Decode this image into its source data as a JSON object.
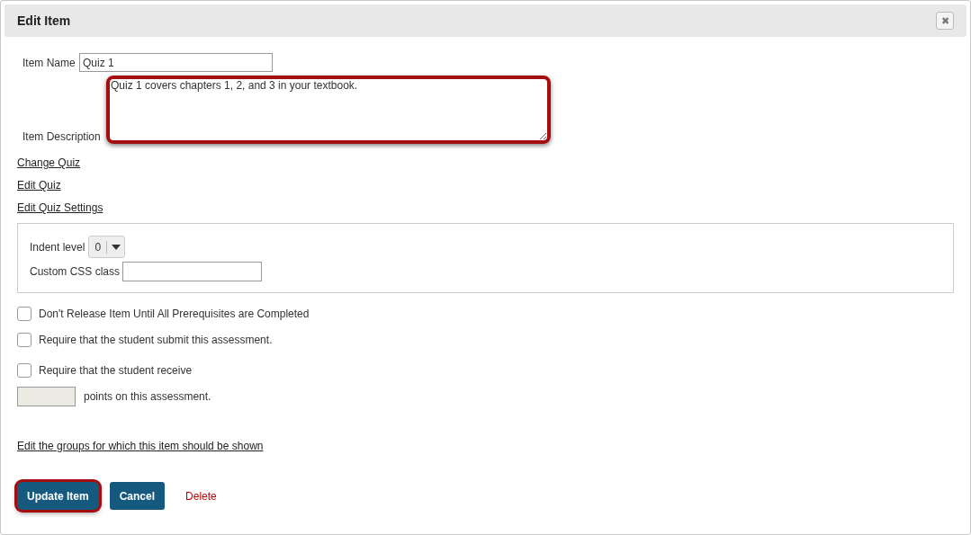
{
  "dialog": {
    "title": "Edit Item",
    "close_glyph": "✖"
  },
  "form": {
    "item_name": {
      "label": "Item Name",
      "value": "Quiz 1"
    },
    "item_description": {
      "label": "Item Description",
      "value": "Quiz 1 covers chapters 1, 2, and 3 in your textbook.",
      "highlighted": true
    }
  },
  "links": [
    "Change Quiz",
    "Edit Quiz",
    "Edit Quiz Settings"
  ],
  "settings": {
    "indent_level": {
      "label": "Indent level",
      "value": "0"
    },
    "css_class": {
      "label": "Custom CSS class"
    }
  },
  "checkboxes": [
    {
      "label": "Don't Release Item Until All Prerequisites are Completed",
      "checked": false
    },
    {
      "label": "Require that the student submit this assessment.",
      "checked": false
    },
    {
      "label": "Require that the student receive",
      "checked": false
    }
  ],
  "points": {
    "suffix": "points on this assessment.",
    "disabled": true
  },
  "groups_link": "Edit the groups for which this item should be shown",
  "buttons": [
    {
      "kind": "primary",
      "label": "Update Item",
      "highlighted": true
    },
    {
      "kind": "primary",
      "label": "Cancel",
      "highlighted": false
    },
    {
      "kind": "danger",
      "label": "Delete",
      "highlighted": false
    }
  ]
}
